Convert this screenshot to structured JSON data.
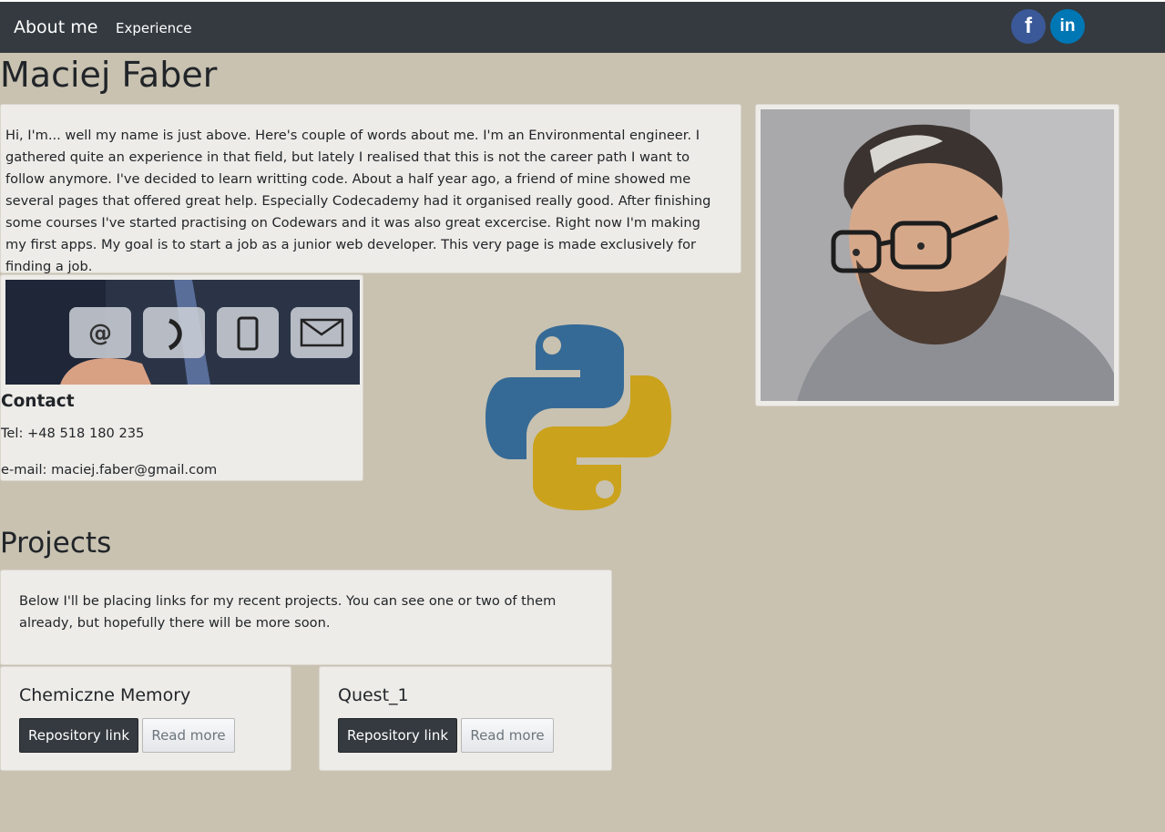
{
  "nav": {
    "brand": "About me",
    "links": [
      "Experience"
    ],
    "social": [
      {
        "icon": "facebook-icon",
        "glyph": "f",
        "color": "#3b5998"
      },
      {
        "icon": "linkedin-icon",
        "glyph": "in",
        "color": "#0077b5"
      }
    ]
  },
  "profile": {
    "name": "Maciej Faber",
    "about": "Hi, I'm... well my name is just above. Here's couple of words about me. I'm an Environmental engineer. I gathered quite an experience in that field, but lately I realised that this is not the career path I want to follow anymore. I've decided to learn writting code. About a half year ago, a friend of mine showed me several pages that offered great help. Especially Codecademy had it organised really good. After finishing some courses I've started practising on Codewars and it was also great excercise. Right now I'm making my first apps. My goal is to start a job as a junior web developer. This very page is made exclusively for finding a job."
  },
  "contact": {
    "title": "Contact",
    "tel": "Tel: +48 518 180 235",
    "email": "e-mail: maciej.faber@gmail.com",
    "icons": [
      "at-icon",
      "phone-icon",
      "mobile-icon",
      "envelope-icon"
    ]
  },
  "projects": {
    "title": "Projects",
    "intro": "Below I'll be placing links for my recent projects. You can see one or two of them already, but hopefully there will be more soon.",
    "items": [
      {
        "name": "Chemiczne Memory",
        "repo_label": "Repository link",
        "more_label": "Read more"
      },
      {
        "name": "Quest_1",
        "repo_label": "Repository link",
        "more_label": "Read more"
      }
    ]
  },
  "colors": {
    "page_bg": "#c9c2b1",
    "navbar": "#343a40",
    "card_bg": "#eeece8",
    "python_blue": "#366a96",
    "python_yellow": "#cba21c"
  }
}
